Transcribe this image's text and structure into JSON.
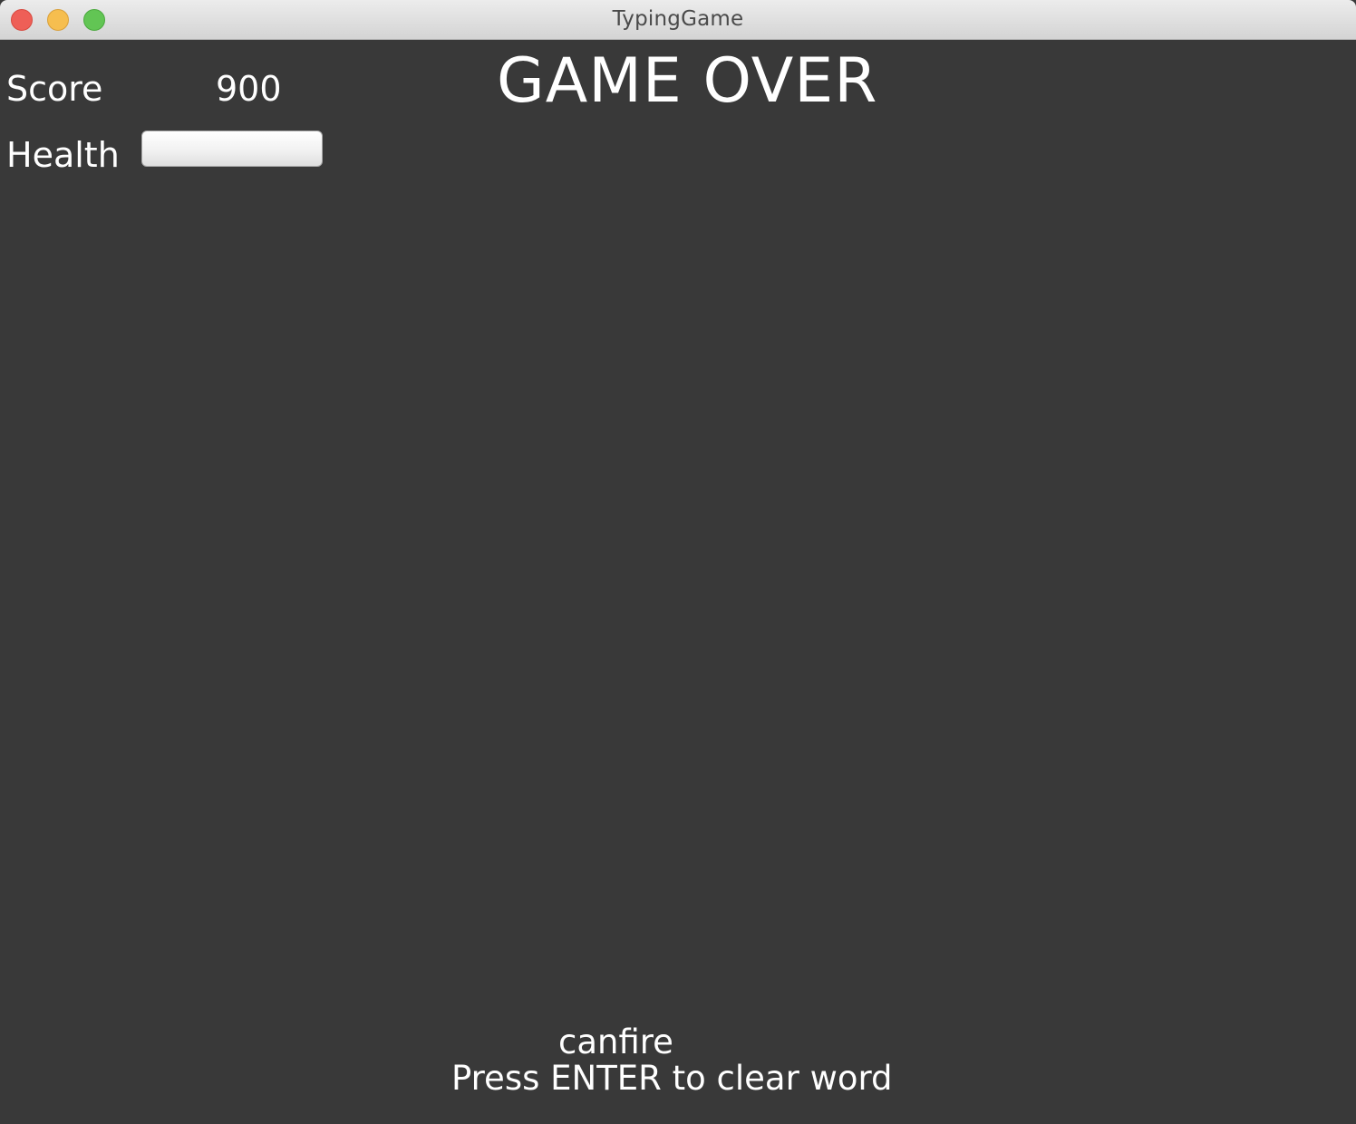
{
  "window": {
    "title": "TypingGame"
  },
  "hud": {
    "score_label": "Score",
    "score_value": "900",
    "health_label": "Health",
    "health_fraction": 0
  },
  "game": {
    "status": "GAME OVER",
    "typed_word": "canfire",
    "hint": "Press ENTER to clear word"
  },
  "colors": {
    "background": "#393939",
    "text": "#ffffff",
    "close_button": "#ee5f57",
    "minimize_button": "#f6be4f",
    "zoom_button": "#62c554"
  }
}
